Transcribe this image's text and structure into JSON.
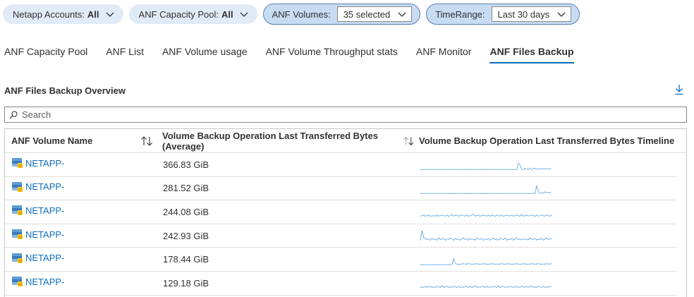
{
  "parameters": [
    {
      "label": "Netapp Accounts:",
      "value": "All",
      "style": "pill"
    },
    {
      "label": "ANF Capacity Pool:",
      "value": "All",
      "style": "pill"
    },
    {
      "label": "ANF Volumes:",
      "value": "35 selected",
      "style": "dropdown"
    },
    {
      "label": "TimeRange:",
      "value": "Last 30 days",
      "style": "dropdown"
    }
  ],
  "tabs": [
    {
      "label": "ANF Capacity Pool",
      "active": false
    },
    {
      "label": "ANF List",
      "active": false
    },
    {
      "label": "ANF Volume usage",
      "active": false
    },
    {
      "label": "ANF Volume Throughput stats",
      "active": false
    },
    {
      "label": "ANF Monitor",
      "active": false
    },
    {
      "label": "ANF Files Backup",
      "active": true
    }
  ],
  "section": {
    "title": "ANF Files Backup Overview",
    "download_icon": "download-icon"
  },
  "search": {
    "placeholder": "Search",
    "icon": "search-icon"
  },
  "table": {
    "columns": [
      "ANF Volume Name",
      "Volume Backup Operation Last Transferred Bytes (Average)",
      "Volume Backup Operation Last Transferred Bytes Timeline"
    ],
    "rows": [
      {
        "name": "NETAPP-",
        "bytes": "366.83 GiB",
        "timeline": [
          0,
          0,
          0,
          0,
          0,
          0,
          0,
          0,
          0,
          0,
          0,
          0,
          0,
          0,
          0,
          0,
          0,
          0,
          0,
          0,
          0,
          0,
          0,
          0,
          0,
          0,
          0,
          0,
          0,
          0,
          0.05,
          0.05,
          0.05,
          0.05,
          0.05,
          0.05,
          0.05,
          0.05,
          0.05,
          0.05,
          0.05,
          0.05,
          0.05,
          0.05,
          0.05,
          0.05,
          0.05,
          0.05,
          0.05,
          0.05,
          0.05,
          0.05,
          0.05,
          0.05,
          0.05,
          0.05,
          0.05,
          0.05,
          0.05,
          0.05,
          0.05,
          0.05,
          0.05,
          0.05,
          0.05,
          0.05,
          0.05,
          0.05,
          0.05,
          0.05,
          0.05,
          0.05,
          0.05,
          0.05,
          0.05,
          0.05,
          0.05,
          0.05,
          0.05,
          0.05,
          0.05,
          0.05,
          0.05,
          0.05,
          0.05,
          0.05,
          0.05,
          0.05,
          0.05,
          0.05,
          0.05,
          0.05,
          0.05,
          0.05,
          0.05,
          0.05,
          0.05,
          0.05,
          0.05,
          0.05,
          0.05,
          0.05,
          0.05,
          0.05,
          0.05,
          0.05,
          0.05,
          0.05,
          0.05,
          0.05,
          0.05,
          0.05,
          0.05,
          0.05,
          0.05,
          0.05,
          0.05,
          0.05,
          0.05,
          0.05,
          0.05,
          0.05,
          0.05,
          0.05,
          0.05,
          0.05,
          0.05,
          0.05,
          0.05,
          0.05,
          0.05,
          0.05,
          0.05,
          0.05,
          0.05,
          0.05,
          0.05,
          0.05,
          0.05,
          0.05,
          0.05,
          0.05,
          0.05,
          0.05,
          0.05,
          0.05,
          0.05,
          0.05,
          0.05,
          0.05,
          0.05,
          0.05,
          0.05,
          0.05,
          0.05,
          0.05,
          0.05,
          0.05,
          0.05,
          0.05,
          0.05,
          0.05,
          0.05,
          0.05,
          0.05,
          0.05,
          0.05,
          0.05,
          0.05,
          0.05,
          0.05,
          0.05,
          0.05,
          0.05,
          0.05,
          0.05,
          0.05,
          0.05,
          0.05,
          0.05,
          0.05,
          0.05
        ]
      },
      {
        "name": "NETAPP-",
        "bytes": "281.52 GiB",
        "timeline": []
      },
      {
        "name": "NETAPP-",
        "bytes": "244.08 GiB",
        "timeline": []
      },
      {
        "name": "NETAPP-",
        "bytes": "242.93 GiB",
        "timeline": []
      },
      {
        "name": "NETAPP-",
        "bytes": "178.44 GiB",
        "timeline": []
      },
      {
        "name": "NETAPP-",
        "bytes": "129.18 GiB",
        "timeline": []
      }
    ]
  },
  "sparklines": [
    [
      0.05,
      0.05,
      0.05,
      0.05,
      0.05,
      0.05,
      0.05,
      0.05,
      0.05,
      0.05,
      0.05,
      0.05,
      0.05,
      0.05,
      0.05,
      0.05,
      0.05,
      0.05,
      0.05,
      0.05,
      0.05,
      0.05,
      0.05,
      0.05,
      0.05,
      0.05,
      0.05,
      0.05,
      0.05,
      0.05,
      0.05,
      0.05,
      0.05,
      0.05,
      0.05,
      0.05,
      0.05,
      0.05,
      0.05,
      0.05,
      0.05,
      0.05,
      0.05,
      0.05,
      0.05,
      0.05,
      0.05,
      0.05,
      0.05,
      0.05,
      0.05,
      0.05,
      0.05,
      0.05,
      0.05,
      0.05,
      0.05,
      0.05,
      0.05,
      0.6,
      0.45,
      0.1,
      0.05,
      0.15,
      0.1,
      0.05,
      0.15,
      0.05,
      0.1,
      0.15,
      0.05,
      0.1,
      0.1,
      0.1,
      0.1,
      0.1,
      0.1,
      0.1,
      0.1,
      0.1
    ],
    [
      0.05,
      0.05,
      0.05,
      0.05,
      0.05,
      0.05,
      0.05,
      0.05,
      0.05,
      0.05,
      0.05,
      0.05,
      0.05,
      0.05,
      0.05,
      0.05,
      0.05,
      0.05,
      0.05,
      0.05,
      0.05,
      0.05,
      0.05,
      0.05,
      0.05,
      0.05,
      0.05,
      0.05,
      0.05,
      0.05,
      0.05,
      0.05,
      0.05,
      0.05,
      0.05,
      0.05,
      0.05,
      0.05,
      0.05,
      0.05,
      0.05,
      0.05,
      0.05,
      0.05,
      0.05,
      0.05,
      0.05,
      0.05,
      0.05,
      0.05,
      0.05,
      0.05,
      0.05,
      0.05,
      0.05,
      0.05,
      0.05,
      0.05,
      0.05,
      0.05,
      0.05,
      0.05,
      0.05,
      0.05,
      0.05,
      0.05,
      0.05,
      0.05,
      0.05,
      0.05,
      0.7,
      0.25,
      0.05,
      0.1,
      0.1,
      0.2,
      0.1,
      0.15,
      0.1,
      0.15
    ],
    [
      0.1,
      0.15,
      0.2,
      0.1,
      0.15,
      0.2,
      0.1,
      0.1,
      0.15,
      0.1,
      0.2,
      0.1,
      0.15,
      0.2,
      0.15,
      0.1,
      0.2,
      0.1,
      0.15,
      0.25,
      0.1,
      0.15,
      0.2,
      0.1,
      0.15,
      0.2,
      0.15,
      0.1,
      0.2,
      0.1,
      0.15,
      0.2,
      0.25,
      0.1,
      0.15,
      0.2,
      0.1,
      0.15,
      0.2,
      0.15,
      0.1,
      0.2,
      0.1,
      0.2,
      0.15,
      0.1,
      0.2,
      0.15,
      0.1,
      0.2,
      0.1,
      0.15,
      0.2,
      0.15,
      0.1,
      0.2,
      0.1,
      0.15,
      0.2,
      0.15,
      0.1,
      0.25,
      0.1,
      0.15,
      0.2,
      0.1,
      0.15,
      0.2,
      0.15,
      0.1,
      0.2,
      0.1,
      0.15,
      0.2,
      0.15,
      0.1,
      0.2,
      0.15,
      0.1,
      0.2
    ],
    [
      0.1,
      0.95,
      0.3,
      0.25,
      0.15,
      0.2,
      0.1,
      0.25,
      0.15,
      0.2,
      0.1,
      0.3,
      0.15,
      0.2,
      0.25,
      0.1,
      0.2,
      0.15,
      0.3,
      0.2,
      0.1,
      0.25,
      0.15,
      0.2,
      0.1,
      0.2,
      0.3,
      0.15,
      0.2,
      0.1,
      0.25,
      0.15,
      0.2,
      0.1,
      0.3,
      0.2,
      0.15,
      0.25,
      0.1,
      0.2,
      0.15,
      0.25,
      0.1,
      0.2,
      0.3,
      0.15,
      0.2,
      0.1,
      0.25,
      0.2,
      0.15,
      0.3,
      0.1,
      0.2,
      0.15,
      0.25,
      0.1,
      0.2,
      0.3,
      0.15,
      0.2,
      0.1,
      0.25,
      0.15,
      0.2,
      0.1,
      0.3,
      0.2,
      0.15,
      0.25,
      0.1,
      0.2,
      0.15,
      0.25,
      0.1,
      0.2,
      0.3,
      0.15,
      0.2,
      0.25
    ],
    [
      0.05,
      0.05,
      0.05,
      0.05,
      0.05,
      0.05,
      0.05,
      0.05,
      0.05,
      0.05,
      0.05,
      0.05,
      0.05,
      0.05,
      0.05,
      0.05,
      0.05,
      0.05,
      0.05,
      0.05,
      0.55,
      0.2,
      0.1,
      0.05,
      0.1,
      0.1,
      0.15,
      0.1,
      0.1,
      0.15,
      0.1,
      0.1,
      0.1,
      0.1,
      0.15,
      0.1,
      0.1,
      0.1,
      0.15,
      0.1,
      0.1,
      0.1,
      0.1,
      0.15,
      0.1,
      0.1,
      0.1,
      0.1,
      0.1,
      0.15,
      0.1,
      0.1,
      0.1,
      0.15,
      0.1,
      0.1,
      0.1,
      0.1,
      0.15,
      0.1,
      0.1,
      0.1,
      0.15,
      0.1,
      0.1,
      0.1,
      0.1,
      0.15,
      0.1,
      0.1,
      0.1,
      0.15,
      0.1,
      0.1,
      0.1,
      0.1,
      0.15,
      0.1,
      0.1,
      0.15
    ],
    [
      0.1,
      0.15,
      0.1,
      0.2,
      0.1,
      0.15,
      0.2,
      0.1,
      0.15,
      0.1,
      0.2,
      0.15,
      0.1,
      0.25,
      0.1,
      0.15,
      0.2,
      0.1,
      0.15,
      0.1,
      0.2,
      0.15,
      0.1,
      0.2,
      0.1,
      0.15,
      0.1,
      0.2,
      0.15,
      0.1,
      0.2,
      0.1,
      0.15,
      0.25,
      0.1,
      0.15,
      0.1,
      0.2,
      0.15,
      0.1,
      0.2,
      0.1,
      0.15,
      0.1,
      0.2,
      0.15,
      0.1,
      0.25,
      0.1,
      0.15,
      0.2,
      0.1,
      0.15,
      0.1,
      0.2,
      0.15,
      0.1,
      0.2,
      0.1,
      0.15,
      0.1,
      0.2,
      0.15,
      0.1,
      0.2,
      0.1,
      0.15,
      0.25,
      0.1,
      0.15,
      0.1,
      0.2,
      0.15,
      0.1,
      0.2,
      0.1,
      0.15,
      0.1,
      0.2,
      0.15
    ]
  ],
  "colors": {
    "accent": "#0f6cbd",
    "sparkline": "#2b88d8",
    "pill_bg": "#e1ebf7",
    "pill_selected_bg": "#c7dcf3"
  }
}
